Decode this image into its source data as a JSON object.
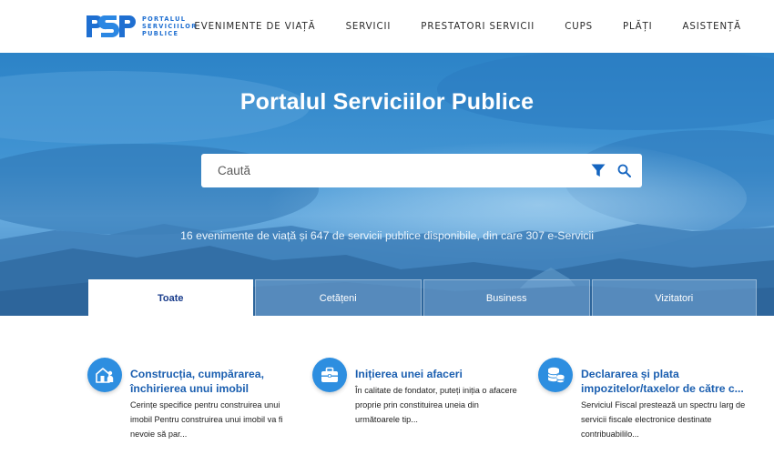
{
  "header": {
    "logo": {
      "mark": "PSP",
      "lines": [
        "PORTALUL",
        "SERVICIILOR",
        "PUBLICE"
      ]
    },
    "nav": [
      {
        "label": "EVENIMENTE DE VIAȚĂ"
      },
      {
        "label": "SERVICII"
      },
      {
        "label": "PRESTATORI SERVICII"
      },
      {
        "label": "CUPS"
      },
      {
        "label": "PLĂȚI"
      },
      {
        "label": "ASISTENȚĂ"
      }
    ]
  },
  "hero": {
    "title": "Portalul Serviciilor Publice",
    "search": {
      "placeholder": "Caută",
      "value": ""
    },
    "stats": "16 evenimente de viață și 647 de servicii publice disponibile, din care 307 e-Servicii"
  },
  "tabs": [
    {
      "label": "Toate",
      "active": true
    },
    {
      "label": "Cetățeni",
      "active": false
    },
    {
      "label": "Business",
      "active": false
    },
    {
      "label": "Vizitatori",
      "active": false
    }
  ],
  "cards": [
    {
      "icon": "house-person-icon",
      "title_lines": [
        "Construcția, cumpărarea,",
        "închirierea unui imobil"
      ],
      "desc_lines": [
        "Cerințe specifice pentru construirea unui",
        "imobil Pentru construirea unui imobil va fi",
        "nevoie să par..."
      ]
    },
    {
      "icon": "briefcase-icon",
      "title_lines": [
        "Inițierea unei afaceri"
      ],
      "desc_lines": [
        "În calitate de fondator, puteți iniția o afacere",
        "proprie prin constituirea uneia din",
        "următoarele tip..."
      ]
    },
    {
      "icon": "coins-icon",
      "title_lines": [
        "Declararea și plata",
        "impozitelor/taxelor de către c..."
      ],
      "desc_lines": [
        "Serviciul Fiscal prestează un spectru larg de",
        "servicii fiscale electronice destinate",
        "contribuabililo..."
      ]
    }
  ],
  "colors": {
    "brand": "#1f6fd1",
    "card_title": "#1b5fb0",
    "icon_bg": "#2d8ee0",
    "active_tab_text": "#1a3d8c"
  }
}
